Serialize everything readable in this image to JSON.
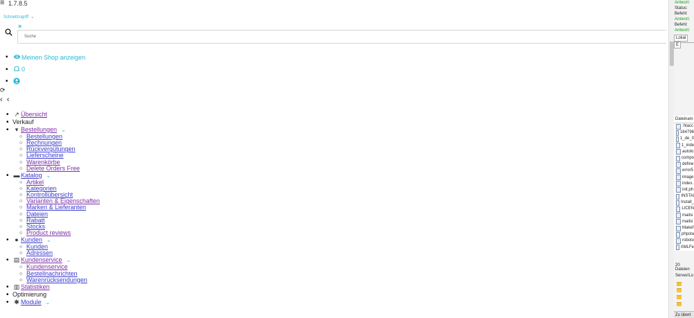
{
  "header": {
    "version": "1.7.8.5",
    "quick_access": "Schnellzugriff",
    "search_placeholder": "Suche"
  },
  "header_links": [
    {
      "icon": "eye-icon",
      "label": "Meinen Shop anzeigen"
    },
    {
      "icon": "bell-icon",
      "label": "0"
    },
    {
      "icon": "user-icon",
      "label": ""
    }
  ],
  "nav": {
    "overview": "Übersicht",
    "sales_heading": "Verkauf",
    "orders": {
      "label": "Bestellungen",
      "children": [
        "Bestellungen",
        "Rechnungen",
        "Rückvergütungen",
        "Lieferscheine",
        "Warenkörbe",
        "Delete Orders Free"
      ]
    },
    "catalog": {
      "label": "Katalog",
      "children": [
        "Artikel",
        "Kategorien",
        "Kontrollübersicht",
        "Varianten & Eigenschaften",
        "Marken & Lieferanten",
        "Dateien",
        "Rabatt",
        "Stocks",
        "Product reviews"
      ]
    },
    "customers": {
      "label": "Kunden",
      "children": [
        "Kunden",
        "Adressen"
      ]
    },
    "service": {
      "label": "Kundenservice",
      "children": [
        "Kundenservice",
        "Bestellnachrichten",
        "Warenrücksendungen"
      ]
    },
    "stats": "Statistiken",
    "optimization_heading": "Optimierung",
    "modules": "Module"
  },
  "ftp_panel": {
    "log": [
      "Antwort:",
      "Status:",
      "Befehl:",
      "Antwort:",
      "Befehl:",
      "Antwort:"
    ],
    "tabs": [
      "Lokal",
      "E"
    ],
    "file_header": "Dateinam",
    "files": [
      ".htacc",
      "164796",
      "1_de_0",
      "1_inde",
      "autolo",
      "compo",
      "define",
      "error5",
      "image",
      "index.",
      "init.ph",
      "INSTAl",
      "Install_",
      "LICEN",
      "mailsi",
      "mailsi",
      "Makef",
      "phpsta",
      "roboto",
      "XMLFe"
    ],
    "file_count": "20 Dateien",
    "server_label": "Server/Lo",
    "queue_button": "Zu übert"
  },
  "colors": {
    "accent": "#25b9d7",
    "link": "#3a3ad0",
    "visited": "#7a2fa6",
    "ftp_green": "#11a011"
  }
}
